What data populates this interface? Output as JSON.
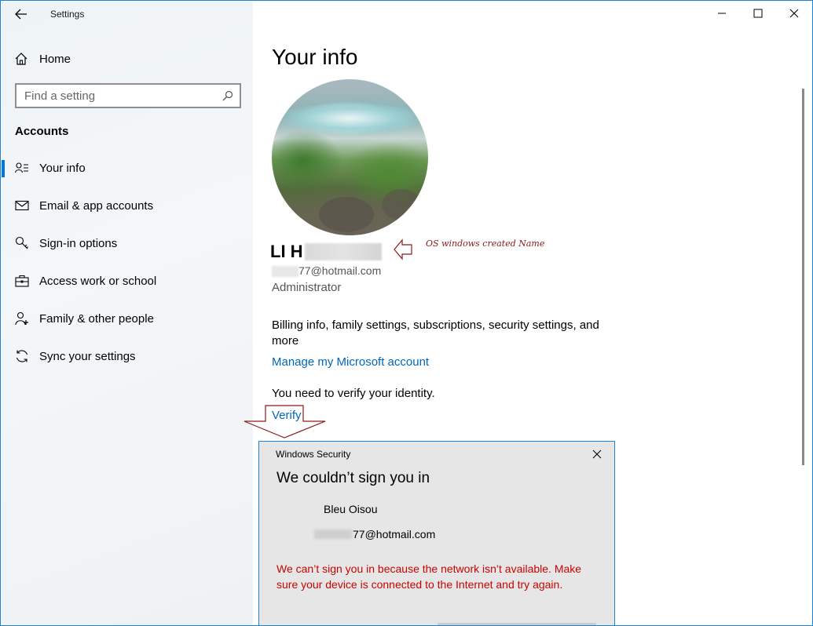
{
  "window": {
    "title": "Settings"
  },
  "sidebar": {
    "home_label": "Home",
    "search_placeholder": "Find a setting",
    "section_title": "Accounts",
    "items": [
      {
        "label": "Your info",
        "icon": "person-card-icon",
        "active": true
      },
      {
        "label": "Email & app accounts",
        "icon": "mail-icon",
        "active": false
      },
      {
        "label": "Sign-in options",
        "icon": "key-icon",
        "active": false
      },
      {
        "label": "Access work or school",
        "icon": "briefcase-icon",
        "active": false
      },
      {
        "label": "Family & other people",
        "icon": "person-add-icon",
        "active": false
      },
      {
        "label": "Sync your settings",
        "icon": "sync-icon",
        "active": false
      }
    ]
  },
  "main": {
    "title": "Your info",
    "user_name": "LI H",
    "annotation": "OS windows created Name",
    "email_suffix": "77@hotmail.com",
    "role": "Administrator",
    "billing_text": "Billing info, family settings, subscriptions, security settings, and more",
    "manage_link": "Manage my Microsoft account",
    "verify_message": "You need to verify your identity.",
    "verify_link": "Verify"
  },
  "dialog": {
    "title": "Windows Security",
    "heading": "We couldn’t sign you in",
    "user": "Bleu Oisou",
    "email_suffix": "77@hotmail.com",
    "error_text": "We can’t sign you in because the network isn’t available. Make sure your device is connected to the Internet and try again."
  },
  "colors": {
    "accent": "#0078d7",
    "link": "#0067b8",
    "error": "#c50500",
    "annotation": "#8b1a1a"
  }
}
